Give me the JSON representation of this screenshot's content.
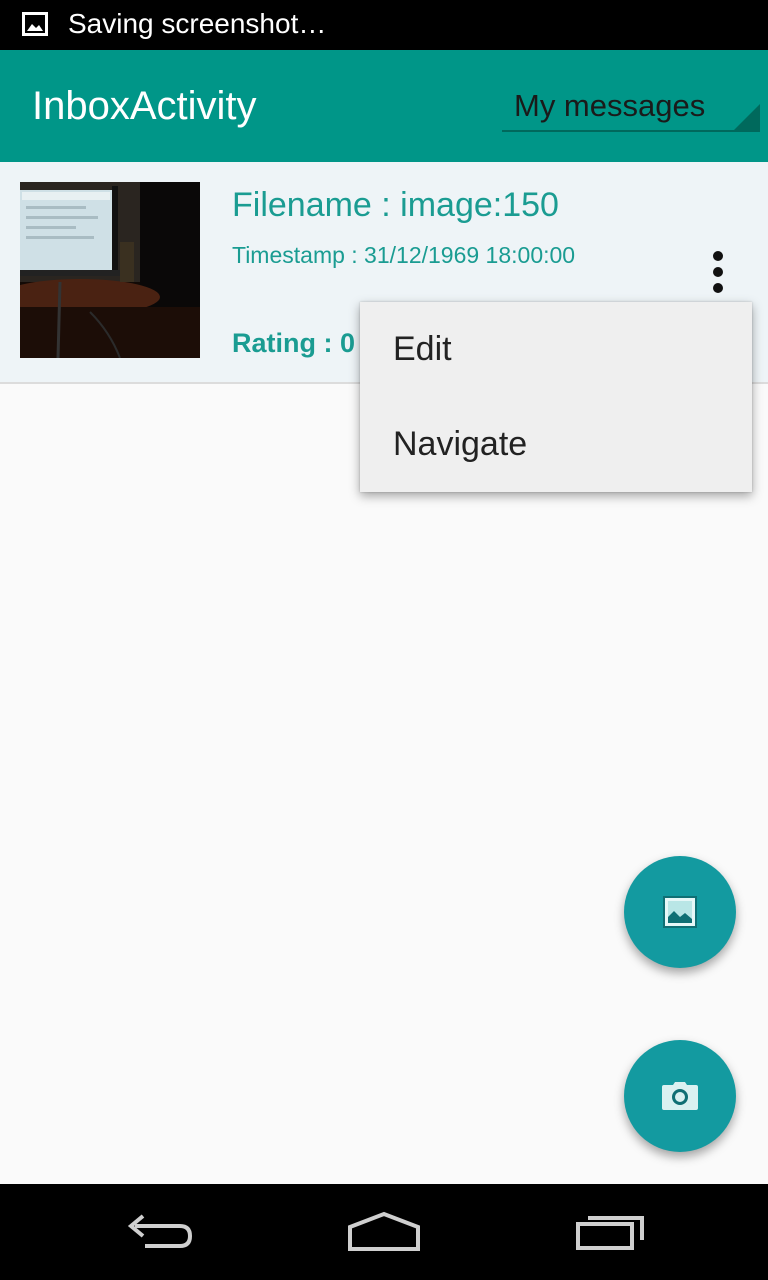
{
  "status_bar": {
    "notification_icon": "image-icon",
    "text": "Saving screenshot…"
  },
  "app_bar": {
    "title": "InboxActivity",
    "spinner_value": "My messages",
    "color": "#009688"
  },
  "message": {
    "filename": "Filename : image:150",
    "timestamp": "Timestamp : 31/12/1969 18:00:00",
    "rating": "Rating : 0",
    "thumbnail_icon": "photo-thumbnail",
    "text_color": "#1a9c92"
  },
  "popup_menu": {
    "items": [
      {
        "label": "Edit"
      },
      {
        "label": "Navigate"
      }
    ]
  },
  "fabs": {
    "gallery_icon": "gallery-icon",
    "camera_icon": "camera-icon",
    "color": "#139aa0"
  },
  "nav_bar": {
    "back_icon": "back-icon",
    "home_icon": "home-icon",
    "recents_icon": "recents-icon"
  }
}
